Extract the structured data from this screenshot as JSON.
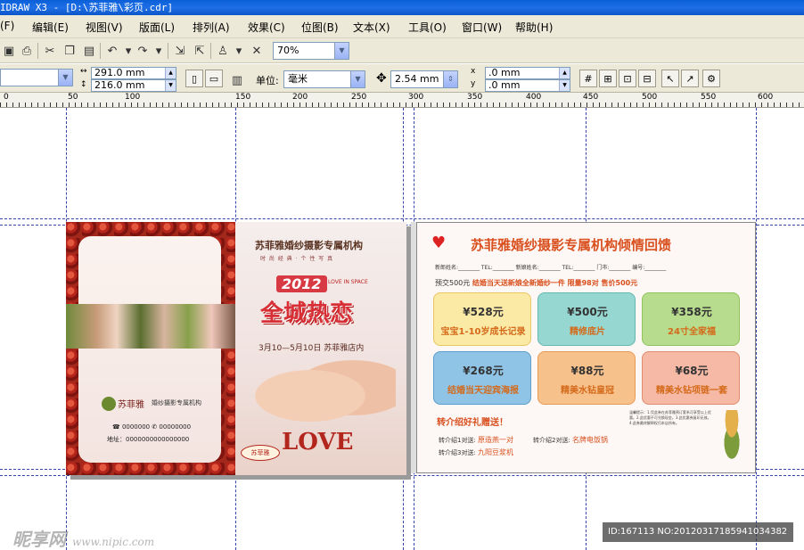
{
  "window": {
    "title": "IDRAW X3 - [D:\\苏菲雅\\彩页.cdr]"
  },
  "menu": [
    "(F)",
    "编辑(E)",
    "视图(V)",
    "版面(L)",
    "排列(A)",
    "效果(C)",
    "位图(B)",
    "文本(X)",
    "工具(O)",
    "窗口(W)",
    "帮助(H)"
  ],
  "toolbar": {
    "zoom": "70%"
  },
  "propertybar": {
    "width": "291.0 mm",
    "height": "216.0 mm",
    "unit_label": "单位:",
    "unit": "毫米",
    "nudge": "2.54 mm",
    "dup_x": ".0 mm",
    "dup_y": ".0 mm"
  },
  "ruler": [
    "0",
    "50",
    "100",
    "150",
    "200",
    "250",
    "300",
    "350",
    "400",
    "450",
    "500",
    "550",
    "600"
  ],
  "left_flyer": {
    "title": "苏菲雅婚纱摄影专属机构",
    "subtitle": "时 尚 经 典 · 个 性 写 真",
    "year": "2012",
    "love_tag": "LOVE IN SPACE",
    "slogan": "全城热恋",
    "date": "3月10—5月10日  苏菲雅店内",
    "brand": "苏菲雅",
    "brand_sub": "婚纱摄影专属机构",
    "tel": "☎ 0000000  ✆ 00000000",
    "address": "地址：0000000000000000",
    "love_logo": "LOVE",
    "badge": "苏菲雅"
  },
  "right_flyer": {
    "title": "苏菲雅婚纱摄影专属机构倾情回馈",
    "fields": "新郎姓名:________ TEL:________ 新娘姓名:________ TEL:________ 门市:________ 编号:________",
    "promo_prefix": "预交500元",
    "promo": "结婚当天送新娘全新婚纱一件 限量98对 售价500元",
    "cards": [
      {
        "price": "¥528元",
        "desc": "宝宝1-10岁成长记录"
      },
      {
        "price": "¥500元",
        "desc": "精修底片"
      },
      {
        "price": "¥358元",
        "desc": "24寸全家福"
      },
      {
        "price": "¥268元",
        "desc": "结婚当天迎宾海报"
      },
      {
        "price": "¥88元",
        "desc": "精美水钻皇冠"
      },
      {
        "price": "¥68元",
        "desc": "精美水钻项链一套"
      }
    ],
    "referral_title": "转介绍好礼赠送！",
    "ref1_label": "转介绍1对送:",
    "ref1_gift": "原造燕一对",
    "ref2_label": "转介绍2对送:",
    "ref2_gift": "名牌电饭锅",
    "ref3_label": "转介绍3对送:",
    "ref3_gift": "九阳豆浆机",
    "notes": "温馨提示：1.凭此券在苏菲雅预订套系可享受以上优惠。2.此优惠不可兑换现金。3.此优惠券复印无效。4.此券最终解释权归本店所有。"
  },
  "watermark": {
    "text": "昵享网",
    "url": "www.nipic.com"
  },
  "id_stamp": "ID:167113 NO:20120317185941034382"
}
